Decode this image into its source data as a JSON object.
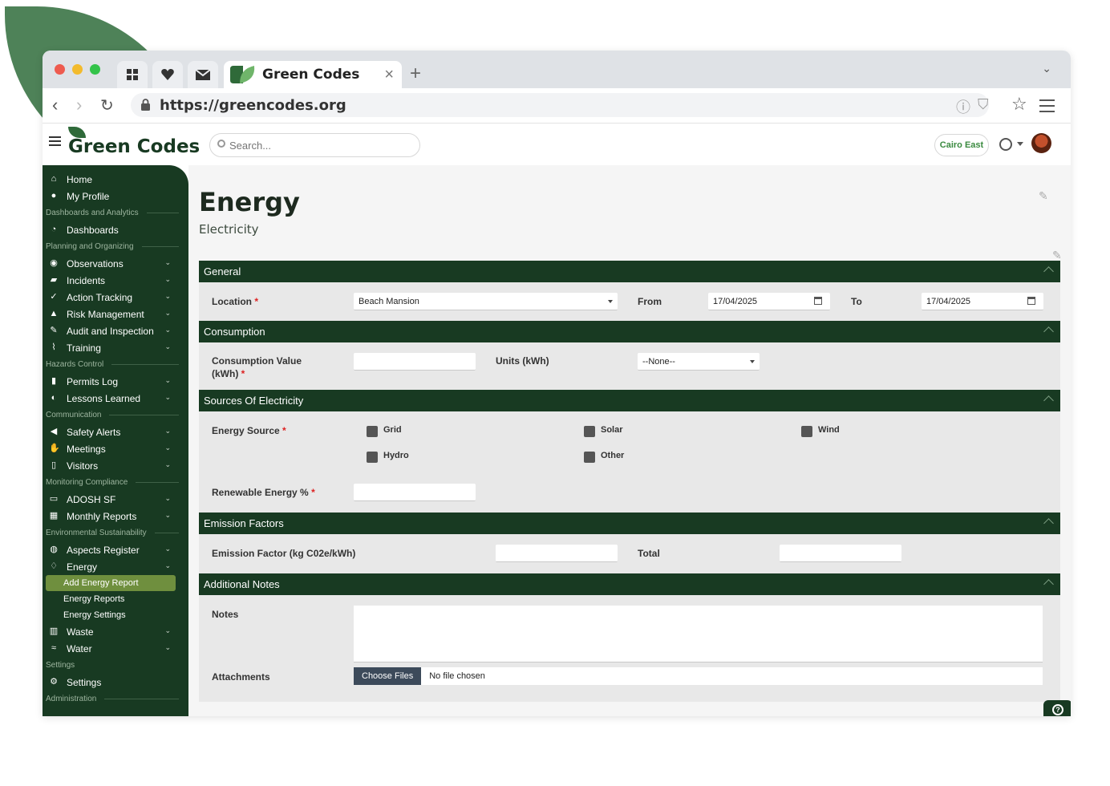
{
  "browser": {
    "tab_title": "Green Codes",
    "url": "https://greencodes.org"
  },
  "app": {
    "logo_text": "Green Codes",
    "search_placeholder": "Search...",
    "location_pill": "Cairo East"
  },
  "sidebar": {
    "items": [
      {
        "kind": "item",
        "label": "Home",
        "icon": "home-icon",
        "chevron": false
      },
      {
        "kind": "item",
        "label": "My Profile",
        "icon": "user-icon",
        "chevron": false
      },
      {
        "kind": "section",
        "label": "Dashboards and Analytics"
      },
      {
        "kind": "item",
        "label": "Dashboards",
        "icon": "pie-chart-icon",
        "chevron": false
      },
      {
        "kind": "section",
        "label": "Planning and Organizing"
      },
      {
        "kind": "item",
        "label": "Observations",
        "icon": "eye-icon",
        "chevron": true
      },
      {
        "kind": "item",
        "label": "Incidents",
        "icon": "briefcase-icon",
        "chevron": true
      },
      {
        "kind": "item",
        "label": "Action Tracking",
        "icon": "check-icon",
        "chevron": true
      },
      {
        "kind": "item",
        "label": "Risk Management",
        "icon": "warning-icon",
        "chevron": true
      },
      {
        "kind": "item",
        "label": "Audit and Inspection",
        "icon": "pen-icon",
        "chevron": true
      },
      {
        "kind": "item",
        "label": "Training",
        "icon": "chart-line-icon",
        "chevron": true
      },
      {
        "kind": "section",
        "label": "Hazards Control"
      },
      {
        "kind": "item",
        "label": "Permits Log",
        "icon": "file-icon",
        "chevron": true
      },
      {
        "kind": "item",
        "label": "Lessons Learned",
        "icon": "brain-icon",
        "chevron": true
      },
      {
        "kind": "section",
        "label": "Communication"
      },
      {
        "kind": "item",
        "label": "Safety Alerts",
        "icon": "megaphone-icon",
        "chevron": true
      },
      {
        "kind": "item",
        "label": "Meetings",
        "icon": "handshake-icon",
        "chevron": true
      },
      {
        "kind": "item",
        "label": "Visitors",
        "icon": "door-icon",
        "chevron": true
      },
      {
        "kind": "section",
        "label": "Monitoring Compliance"
      },
      {
        "kind": "item",
        "label": "ADOSH SF",
        "icon": "folder-icon",
        "chevron": true
      },
      {
        "kind": "item",
        "label": "Monthly Reports",
        "icon": "calendar-check-icon",
        "chevron": true
      },
      {
        "kind": "section",
        "label": "Environmental Sustainability"
      },
      {
        "kind": "item",
        "label": "Aspects Register",
        "icon": "globe-icon",
        "chevron": true
      },
      {
        "kind": "item",
        "label": "Energy",
        "icon": "flame-icon",
        "chevron": true
      },
      {
        "kind": "sub",
        "label": "Add Energy Report",
        "active": true
      },
      {
        "kind": "sub",
        "label": "Energy Reports",
        "active": false
      },
      {
        "kind": "sub",
        "label": "Energy Settings",
        "active": false
      },
      {
        "kind": "item",
        "label": "Waste",
        "icon": "trash-icon",
        "chevron": true
      },
      {
        "kind": "item",
        "label": "Water",
        "icon": "water-tap-icon",
        "chevron": true
      },
      {
        "kind": "section",
        "label": "Settings",
        "noline": true
      },
      {
        "kind": "item",
        "label": "Settings",
        "icon": "gear-icon",
        "chevron": false
      },
      {
        "kind": "section",
        "label": "Administration"
      }
    ]
  },
  "page": {
    "title": "Energy",
    "subtitle": "Electricity"
  },
  "general": {
    "heading": "General",
    "location_label": "Location",
    "location_value": "Beach Mansion",
    "from_label": "From",
    "from_value": "17/04/2025",
    "to_label": "To",
    "to_value": "17/04/2025"
  },
  "consumption": {
    "heading": "Consumption",
    "value_label": "Consumption Value (kWh)",
    "value": "",
    "units_label": "Units (kWh)",
    "units_value": "--None--"
  },
  "sources": {
    "heading": "Sources Of Electricity",
    "energy_source_label": "Energy Source",
    "options": [
      "Grid",
      "Solar",
      "Wind",
      "Hydro",
      "Other"
    ],
    "renewable_label": "Renewable Energy %"
  },
  "emission": {
    "heading": "Emission Factors",
    "factor_label": "Emission Factor (kg C02e/kWh)",
    "total_label": "Total"
  },
  "notes": {
    "heading": "Additional Notes",
    "notes_label": "Notes",
    "attachments_label": "Attachments",
    "choose_files": "Choose Files",
    "no_file": "No file chosen"
  },
  "required_mark": "*",
  "colors": {
    "brand_dark": "#183a22",
    "accent_green": "#6f8f3e",
    "required": "#dd2222"
  }
}
